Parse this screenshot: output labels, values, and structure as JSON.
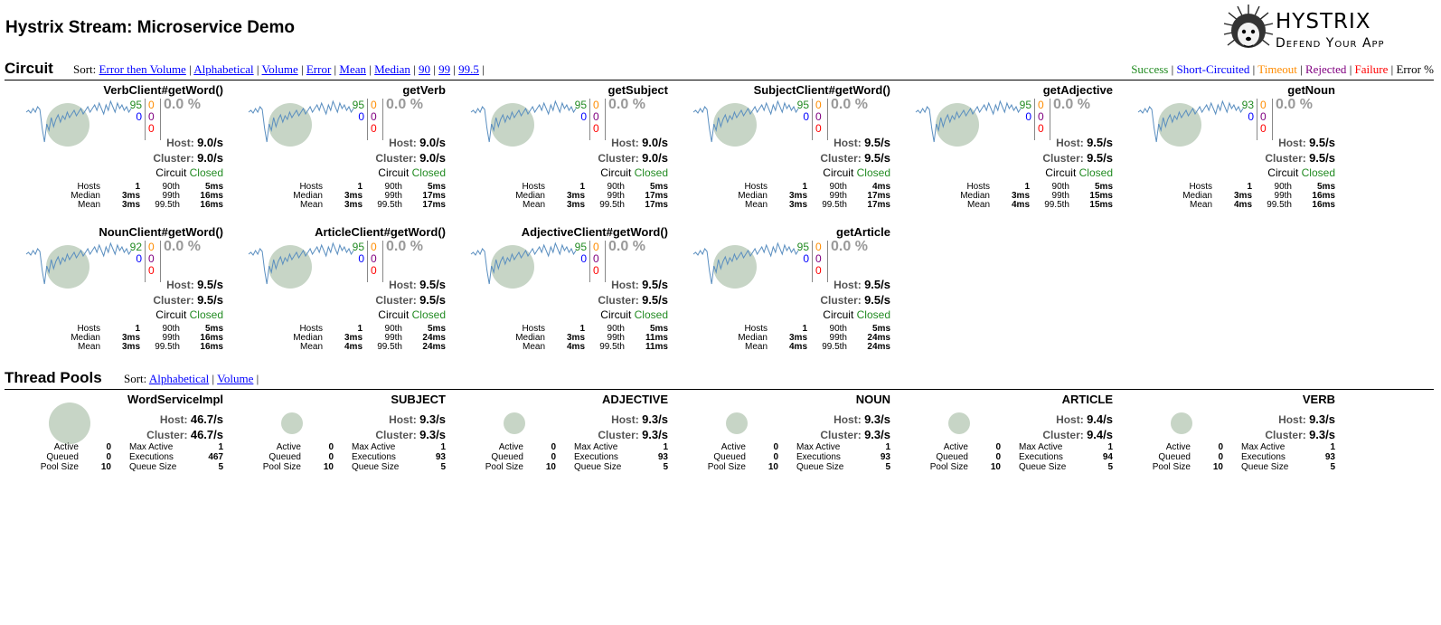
{
  "page_title": "Hystrix Stream: Microservice Demo",
  "logo": {
    "name": "Hystrix",
    "tagline": "Defend Your App"
  },
  "circuit": {
    "title": "Circuit",
    "sort_label": "Sort:",
    "sort_links": [
      "Error then Volume",
      "Alphabetical",
      "Volume",
      "Error",
      "Mean",
      "Median",
      "90",
      "99",
      "99.5"
    ],
    "legend": [
      {
        "label": "Success",
        "color": "#228B22"
      },
      {
        "label": "Short-Circuited",
        "color": "#0000ff"
      },
      {
        "label": "Timeout",
        "color": "#FF8C00"
      },
      {
        "label": "Rejected",
        "color": "#800080"
      },
      {
        "label": "Failure",
        "color": "#ff0000"
      },
      {
        "label": "Error %",
        "color": "#000000"
      }
    ],
    "host_label": "Host:",
    "cluster_label": "Cluster:",
    "circuit_label": "Circuit",
    "stat_labels": {
      "hosts": "Hosts",
      "median": "Median",
      "mean": "Mean",
      "p90": "90th",
      "p99": "99th",
      "p995": "99.5th"
    },
    "cards": [
      {
        "name": "VerbClient#getWord()",
        "success": "95",
        "short_circuited": "0",
        "timeout": "0",
        "rejected": "0",
        "failure": "0",
        "error_pct": "0.0 %",
        "host_rate": "9.0/s",
        "cluster_rate": "9.0/s",
        "circuit_status": "Closed",
        "hosts": "1",
        "median": "3ms",
        "mean": "3ms",
        "p90": "5ms",
        "p99": "16ms",
        "p995": "16ms"
      },
      {
        "name": "getVerb",
        "success": "95",
        "short_circuited": "0",
        "timeout": "0",
        "rejected": "0",
        "failure": "0",
        "error_pct": "0.0 %",
        "host_rate": "9.0/s",
        "cluster_rate": "9.0/s",
        "circuit_status": "Closed",
        "hosts": "1",
        "median": "3ms",
        "mean": "3ms",
        "p90": "5ms",
        "p99": "17ms",
        "p995": "17ms"
      },
      {
        "name": "getSubject",
        "success": "95",
        "short_circuited": "0",
        "timeout": "0",
        "rejected": "0",
        "failure": "0",
        "error_pct": "0.0 %",
        "host_rate": "9.0/s",
        "cluster_rate": "9.0/s",
        "circuit_status": "Closed",
        "hosts": "1",
        "median": "3ms",
        "mean": "3ms",
        "p90": "5ms",
        "p99": "17ms",
        "p995": "17ms"
      },
      {
        "name": "SubjectClient#getWord()",
        "success": "95",
        "short_circuited": "0",
        "timeout": "0",
        "rejected": "0",
        "failure": "0",
        "error_pct": "0.0 %",
        "host_rate": "9.5/s",
        "cluster_rate": "9.5/s",
        "circuit_status": "Closed",
        "hosts": "1",
        "median": "3ms",
        "mean": "3ms",
        "p90": "4ms",
        "p99": "17ms",
        "p995": "17ms"
      },
      {
        "name": "getAdjective",
        "success": "95",
        "short_circuited": "0",
        "timeout": "0",
        "rejected": "0",
        "failure": "0",
        "error_pct": "0.0 %",
        "host_rate": "9.5/s",
        "cluster_rate": "9.5/s",
        "circuit_status": "Closed",
        "hosts": "1",
        "median": "3ms",
        "mean": "4ms",
        "p90": "5ms",
        "p99": "15ms",
        "p995": "15ms"
      },
      {
        "name": "getNoun",
        "success": "93",
        "short_circuited": "0",
        "timeout": "0",
        "rejected": "0",
        "failure": "0",
        "error_pct": "0.0 %",
        "host_rate": "9.5/s",
        "cluster_rate": "9.5/s",
        "circuit_status": "Closed",
        "hosts": "1",
        "median": "3ms",
        "mean": "4ms",
        "p90": "5ms",
        "p99": "16ms",
        "p995": "16ms"
      },
      {
        "name": "NounClient#getWord()",
        "success": "92",
        "short_circuited": "0",
        "timeout": "0",
        "rejected": "0",
        "failure": "0",
        "error_pct": "0.0 %",
        "host_rate": "9.5/s",
        "cluster_rate": "9.5/s",
        "circuit_status": "Closed",
        "hosts": "1",
        "median": "3ms",
        "mean": "3ms",
        "p90": "5ms",
        "p99": "16ms",
        "p995": "16ms"
      },
      {
        "name": "ArticleClient#getWord()",
        "success": "95",
        "short_circuited": "0",
        "timeout": "0",
        "rejected": "0",
        "failure": "0",
        "error_pct": "0.0 %",
        "host_rate": "9.5/s",
        "cluster_rate": "9.5/s",
        "circuit_status": "Closed",
        "hosts": "1",
        "median": "3ms",
        "mean": "4ms",
        "p90": "5ms",
        "p99": "24ms",
        "p995": "24ms"
      },
      {
        "name": "AdjectiveClient#getWord()",
        "success": "95",
        "short_circuited": "0",
        "timeout": "0",
        "rejected": "0",
        "failure": "0",
        "error_pct": "0.0 %",
        "host_rate": "9.5/s",
        "cluster_rate": "9.5/s",
        "circuit_status": "Closed",
        "hosts": "1",
        "median": "3ms",
        "mean": "4ms",
        "p90": "5ms",
        "p99": "11ms",
        "p995": "11ms"
      },
      {
        "name": "getArticle",
        "success": "95",
        "short_circuited": "0",
        "timeout": "0",
        "rejected": "0",
        "failure": "0",
        "error_pct": "0.0 %",
        "host_rate": "9.5/s",
        "cluster_rate": "9.5/s",
        "circuit_status": "Closed",
        "hosts": "1",
        "median": "3ms",
        "mean": "4ms",
        "p90": "5ms",
        "p99": "24ms",
        "p995": "24ms"
      }
    ]
  },
  "thread_pools": {
    "title": "Thread Pools",
    "sort_label": "Sort:",
    "sort_links": [
      "Alphabetical",
      "Volume"
    ],
    "host_label": "Host:",
    "cluster_label": "Cluster:",
    "stat_labels": {
      "active": "Active",
      "queued": "Queued",
      "pool_size": "Pool Size",
      "max_active": "Max Active",
      "executions": "Executions",
      "queue_size": "Queue Size"
    },
    "pools": [
      {
        "name": "WordServiceImpl",
        "host_rate": "46.7/s",
        "cluster_rate": "46.7/s",
        "active": "0",
        "queued": "0",
        "pool_size": "10",
        "max_active": "1",
        "executions": "467",
        "queue_size": "5"
      },
      {
        "name": "SUBJECT",
        "host_rate": "9.3/s",
        "cluster_rate": "9.3/s",
        "active": "0",
        "queued": "0",
        "pool_size": "10",
        "max_active": "1",
        "executions": "93",
        "queue_size": "5"
      },
      {
        "name": "ADJECTIVE",
        "host_rate": "9.3/s",
        "cluster_rate": "9.3/s",
        "active": "0",
        "queued": "0",
        "pool_size": "10",
        "max_active": "1",
        "executions": "93",
        "queue_size": "5"
      },
      {
        "name": "NOUN",
        "host_rate": "9.3/s",
        "cluster_rate": "9.3/s",
        "active": "0",
        "queued": "0",
        "pool_size": "10",
        "max_active": "1",
        "executions": "93",
        "queue_size": "5"
      },
      {
        "name": "ARTICLE",
        "host_rate": "9.4/s",
        "cluster_rate": "9.4/s",
        "active": "0",
        "queued": "0",
        "pool_size": "10",
        "max_active": "1",
        "executions": "94",
        "queue_size": "5"
      },
      {
        "name": "VERB",
        "host_rate": "9.3/s",
        "cluster_rate": "9.3/s",
        "active": "0",
        "queued": "0",
        "pool_size": "10",
        "max_active": "1",
        "executions": "93",
        "queue_size": "5"
      }
    ]
  },
  "colors": {
    "success": "#228B22",
    "short": "#0000ff",
    "timeout": "#FF8C00",
    "rejected": "#800080",
    "failure": "#ff0000",
    "closed": "#228B22",
    "circle": "#c7d5c6",
    "spark": "#5b8fc0"
  }
}
